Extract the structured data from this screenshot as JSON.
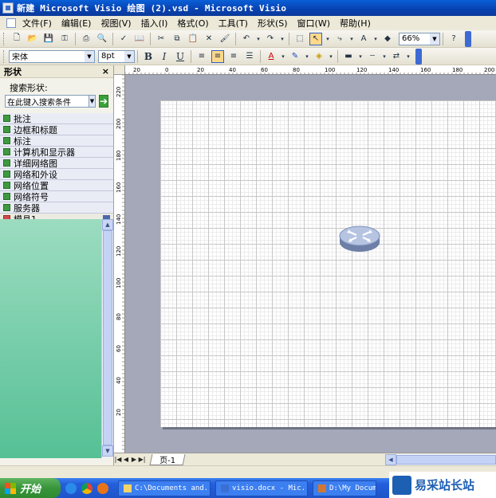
{
  "window": {
    "title": "新建 Microsoft Visio 绘图 (2).vsd - Microsoft Visio"
  },
  "menu": [
    "文件(F)",
    "编辑(E)",
    "视图(V)",
    "插入(I)",
    "格式(O)",
    "工具(T)",
    "形状(S)",
    "窗口(W)",
    "帮助(H)"
  ],
  "toolbar": {
    "zoom": "66%",
    "font": "宋体",
    "font_size": "8pt",
    "bold": "B",
    "italic": "I",
    "underline": "U",
    "font_color_label": "A",
    "text_tool_label": "A"
  },
  "shapes_panel": {
    "title": "形状",
    "close": "×",
    "search_label": "搜索形状:",
    "search_value": "在此键入搜索条件",
    "stencils": [
      "批注",
      "边框和标题",
      "标注",
      "计算机和显示器",
      "详细网络图",
      "网络和外设",
      "网络位置",
      "网络符号",
      "服务器"
    ],
    "open_stencil": "模具1"
  },
  "rulers": {
    "top": [
      "20",
      "0",
      "20",
      "40",
      "60",
      "80",
      "100",
      "120",
      "140",
      "160",
      "180",
      "200"
    ],
    "left": [
      "220",
      "200",
      "180",
      "160",
      "140",
      "120",
      "100",
      "80",
      "60",
      "40",
      "20"
    ]
  },
  "page_tab": "页-1",
  "taskbar": {
    "start": "开始",
    "tasks": [
      "C:\\Documents and...",
      "visio.docx - Mic...",
      "D:\\My Documen..."
    ]
  },
  "watermark": "易采站长站",
  "colors": {
    "title_bar": "#0a46c0",
    "stencil_body": "#6fc9a3",
    "canvas_bg": "#a4a8b8",
    "taskbar": "#245edb"
  }
}
